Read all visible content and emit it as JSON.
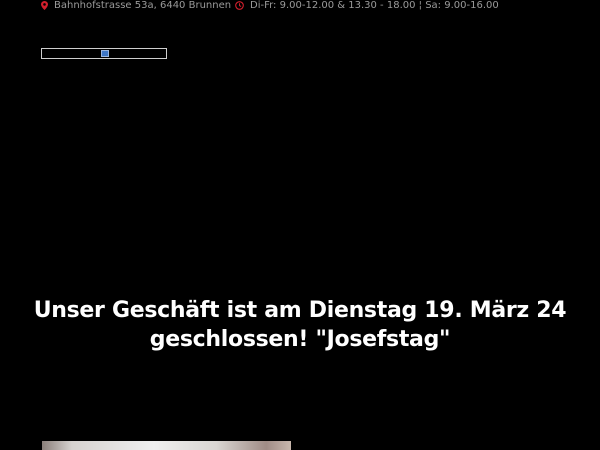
{
  "topbar": {
    "address": "Bahnhofstrasse 53a, 6440 Brunnen",
    "hours": "Di-Fr: 9.00-12.00 & 13.30 - 18.00 ¦ Sa: 9.00-16.00"
  },
  "colors": {
    "background": "#000000",
    "accent": "#d11f2c",
    "topbar_text": "#9a9a9a",
    "headline_text": "#ffffff"
  },
  "headline": {
    "line1": "Unser Geschäft ist am Dienstag 19. März 24",
    "line2": "geschlossen! \"Josefstag\""
  }
}
